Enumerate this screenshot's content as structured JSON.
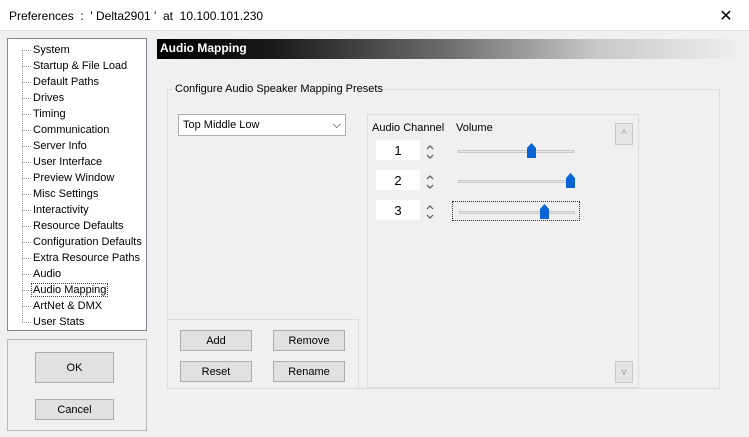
{
  "window": {
    "title": "Preferences  :  ' Delta2901 '  at  10.100.101.230",
    "close_glyph": "✕"
  },
  "tree": {
    "items": [
      {
        "label": "System"
      },
      {
        "label": "Startup & File Load"
      },
      {
        "label": "Default Paths"
      },
      {
        "label": "Drives"
      },
      {
        "label": "Timing"
      },
      {
        "label": "Communication"
      },
      {
        "label": "Server Info"
      },
      {
        "label": "User Interface"
      },
      {
        "label": "Preview Window"
      },
      {
        "label": "Misc Settings"
      },
      {
        "label": "Interactivity"
      },
      {
        "label": "Resource Defaults"
      },
      {
        "label": "Configuration Defaults"
      },
      {
        "label": "Extra Resource Paths"
      },
      {
        "label": "Audio"
      },
      {
        "label": "Audio Mapping"
      },
      {
        "label": "ArtNet & DMX"
      },
      {
        "label": "User Stats"
      }
    ],
    "selected": "Audio Mapping"
  },
  "dialog_buttons": {
    "ok": "OK",
    "cancel": "Cancel"
  },
  "page": {
    "title": "Audio Mapping",
    "group_label": "Configure Audio Speaker Mapping Presets",
    "preset_select": {
      "value": "Top Middle Low",
      "arrow": "⌵"
    },
    "preset_buttons": {
      "add": "Add",
      "remove": "Remove",
      "reset": "Reset",
      "rename": "Rename"
    },
    "channels": {
      "col_channel": "Audio Channel",
      "col_volume": "Volume",
      "rows": [
        {
          "channel": "1",
          "volume": 0.63
        },
        {
          "channel": "2",
          "volume": 0.97
        },
        {
          "channel": "3",
          "volume": 0.74
        }
      ],
      "scroll_up": "^",
      "scroll_down": "v"
    },
    "accent_color": "#0a64d6"
  }
}
